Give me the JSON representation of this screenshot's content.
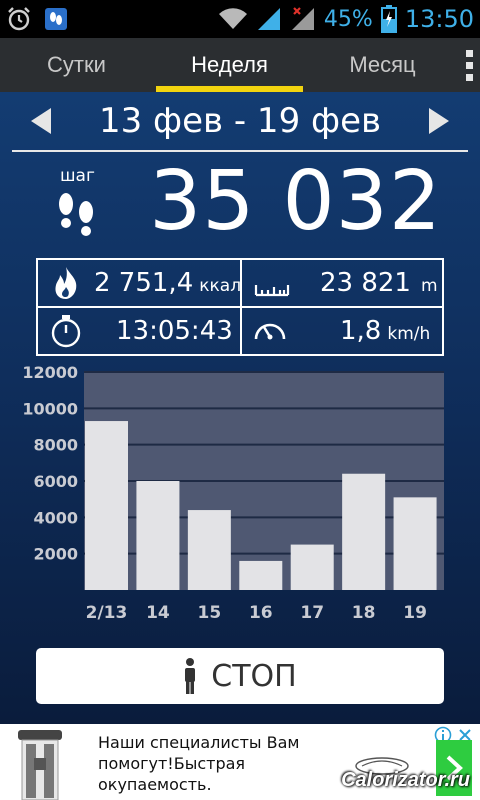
{
  "status_bar": {
    "battery": "45%",
    "time": "13:50",
    "icons": [
      "alarm-icon",
      "pedometer-app-icon",
      "wifi-icon",
      "signal-icon",
      "no-signal-icon",
      "battery-charging-icon"
    ]
  },
  "tabs": [
    {
      "label": "Сутки",
      "active": false
    },
    {
      "label": "Неделя",
      "active": true
    },
    {
      "label": "Месяц",
      "active": false
    }
  ],
  "date_range": {
    "label": "13 фев - 19 фев"
  },
  "steps": {
    "label": "шаг",
    "value": "35 032"
  },
  "stats": {
    "calories": {
      "value": "2 751,4",
      "unit": "ккал"
    },
    "distance": {
      "value": "23 821",
      "unit": "m"
    },
    "time": {
      "value": "13:05:43"
    },
    "speed": {
      "value": "1,8",
      "unit": "km/h"
    }
  },
  "chart_data": {
    "type": "bar",
    "categories": [
      "2/13",
      "14",
      "15",
      "16",
      "17",
      "18",
      "19"
    ],
    "values": [
      9300,
      6000,
      4400,
      1600,
      2500,
      6400,
      5100
    ],
    "ylim": [
      0,
      12000
    ],
    "yticks": [
      "12000",
      "10000",
      "8000",
      "6000",
      "4000",
      "2000"
    ],
    "ytick_values": [
      12000,
      10000,
      8000,
      6000,
      4000,
      2000
    ],
    "bar_color": "#e3e3e6",
    "plot_bg": "#4f5872",
    "grid": true
  },
  "stop_button": {
    "label": "СТОП"
  },
  "ad": {
    "line1": "Наши специалисты Вам",
    "line2": "помогут!Быстрая",
    "line3": "окупаемость.",
    "watermark": "Calorizator.ru"
  },
  "colors": {
    "accent_tab": "#f2d40f",
    "status_text": "#3fb0e8",
    "ad_button": "#2ecc40"
  }
}
